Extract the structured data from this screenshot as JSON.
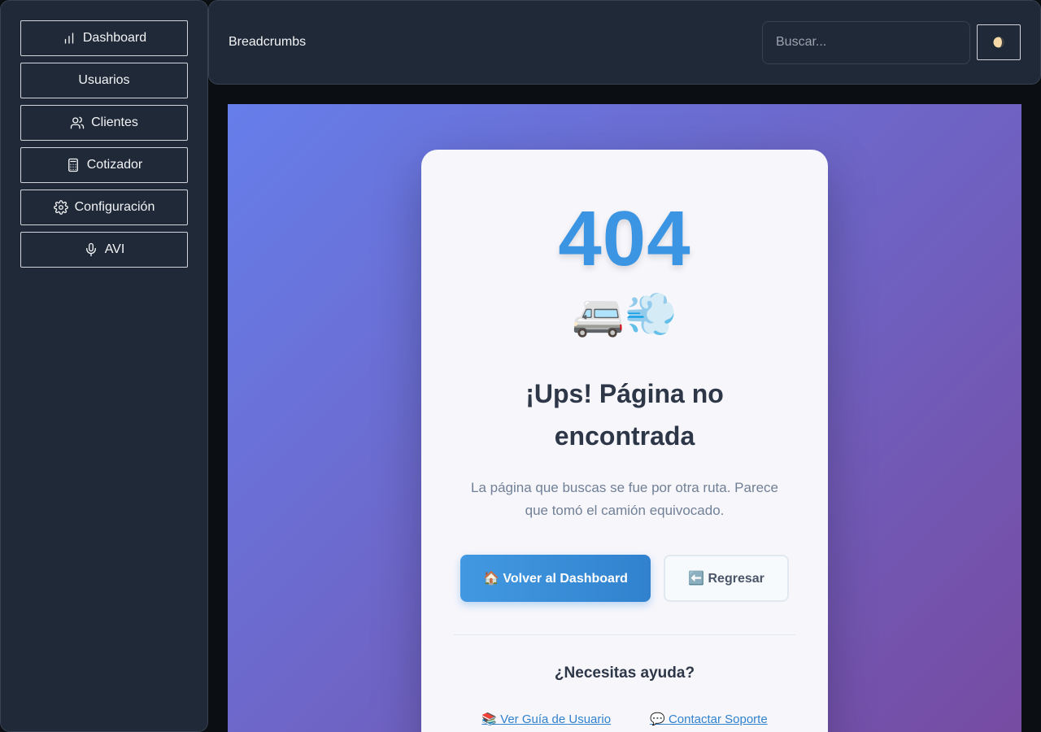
{
  "sidebar": {
    "items": [
      {
        "label": "Dashboard",
        "icon": "bar-chart-icon"
      },
      {
        "label": "Usuarios",
        "icon": ""
      },
      {
        "label": "Clientes",
        "icon": "users-icon"
      },
      {
        "label": "Cotizador",
        "icon": "calculator-icon"
      },
      {
        "label": "Configuración",
        "icon": "gear-icon"
      },
      {
        "label": "AVI",
        "icon": "microphone-icon"
      }
    ]
  },
  "header": {
    "breadcrumbs": "Breadcrumbs",
    "search_placeholder": "Buscar...",
    "theme_toggle_icon": "half-moon-icon"
  },
  "error_page": {
    "code": "404",
    "emoji": "🚐💨",
    "title": "¡Ups! Página no encontrada",
    "description": "La página que buscas se fue por otra ruta. Parece que tomó el camión equivocado.",
    "primary_button": "🏠 Volver al Dashboard",
    "secondary_button": "⬅️ Regresar",
    "help_title": "¿Necesitas ayuda?",
    "links": [
      {
        "icon": "📚",
        "label": "Ver Guía de Usuario"
      },
      {
        "icon": "💬",
        "label": "Contactar Soporte"
      }
    ]
  },
  "colors": {
    "gradient_start": "#667eea",
    "gradient_end": "#764ba2",
    "accent": "#3b95e2",
    "sidebar_bg": "#1f2937"
  }
}
